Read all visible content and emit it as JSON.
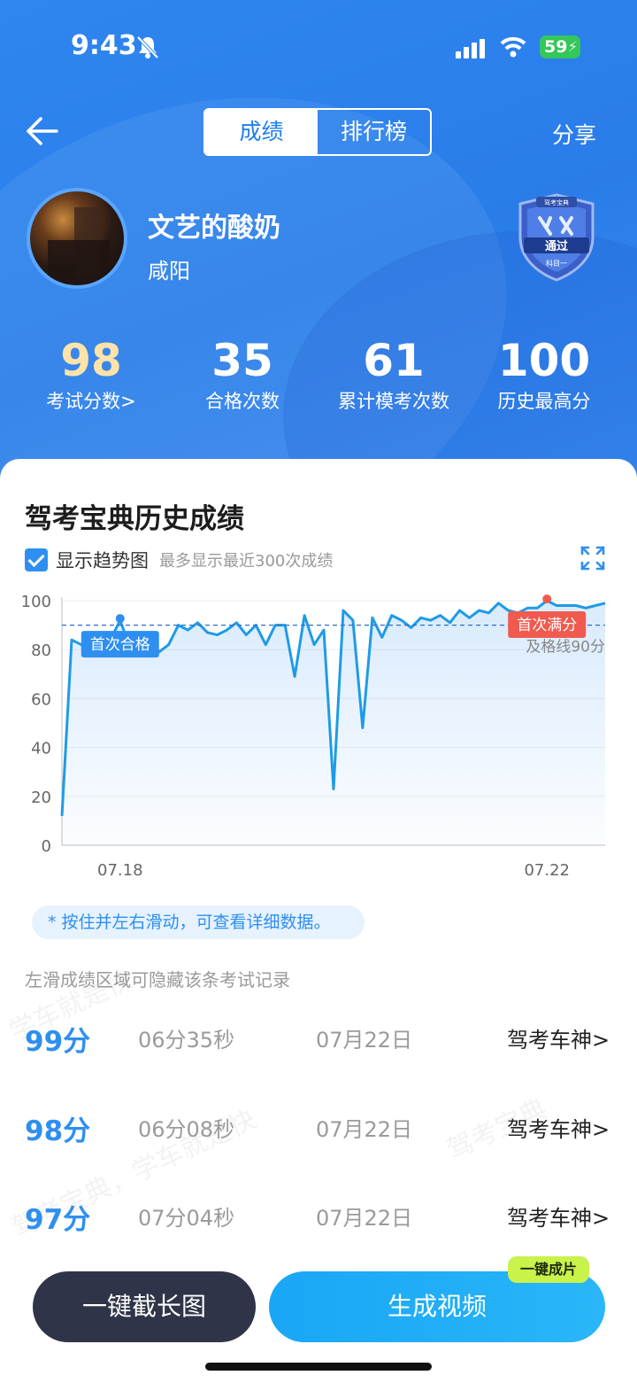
{
  "status_bar": {
    "time": "9:43",
    "battery": "59"
  },
  "header": {
    "tabs": [
      {
        "label": "成绩",
        "active": true
      },
      {
        "label": "排行榜",
        "active": false
      }
    ],
    "share_label": "分享"
  },
  "profile": {
    "name": "文艺的酸奶",
    "city": "咸阳",
    "badge": {
      "brand": "驾考宝典",
      "status": "通过",
      "subject": "科目一"
    }
  },
  "stats": [
    {
      "value": "98",
      "label": "考试分数>"
    },
    {
      "value": "35",
      "label": "合格次数"
    },
    {
      "value": "61",
      "label": "累计模考次数"
    },
    {
      "value": "100",
      "label": "历史最高分"
    }
  ],
  "history": {
    "title": "驾考宝典历史成绩",
    "trend_label": "显示趋势图",
    "trend_hint": "最多显示最近300次成绩",
    "slide_hint": "* 按住并左右滑动，可查看详细数据。",
    "hide_tip": "左滑成绩区域可隐藏该条考试记录"
  },
  "chart_data": {
    "type": "line",
    "ylim": [
      0,
      100
    ],
    "y_ticks": [
      "0",
      "20",
      "40",
      "60",
      "80",
      "100"
    ],
    "x_ticks": [
      "07.18",
      "07.22"
    ],
    "pass_line": {
      "value": 90,
      "label": "及格线90分"
    },
    "annotations": [
      {
        "label": "首次合格",
        "color": "#2e8ff0"
      },
      {
        "label": "首次满分",
        "color": "#f05a4f"
      }
    ],
    "series": [
      {
        "values": [
          12,
          84,
          82,
          79,
          81,
          84,
          92,
          81,
          86,
          85,
          79,
          82,
          90,
          88,
          91,
          87,
          86,
          88,
          91,
          86,
          90,
          82,
          90,
          90,
          69,
          94,
          82,
          88,
          23,
          96,
          92,
          48,
          93,
          85,
          94,
          92,
          89,
          93,
          92,
          94,
          91,
          96,
          93,
          96,
          95,
          99,
          96,
          95,
          97,
          97,
          100,
          98,
          98,
          98,
          97,
          98,
          99
        ]
      }
    ]
  },
  "records": [
    {
      "score": "99分",
      "time": "06分35秒",
      "date": "07月22日",
      "tag": "驾考车神>"
    },
    {
      "score": "98分",
      "time": "06分08秒",
      "date": "07月22日",
      "tag": "驾考车神>"
    },
    {
      "score": "97分",
      "time": "07分04秒",
      "date": "07月22日",
      "tag": "驾考车神>"
    }
  ],
  "watermarks": [
    "学车就是快",
    "驾考宝典，学车就是快",
    "驾考宝典"
  ],
  "buttons": {
    "screenshot": "一键截长图",
    "video": "生成视频",
    "video_tag": "一键成片"
  },
  "colors": {
    "primary": "#2e8ff0",
    "hero": "#2a7de9",
    "accent_red": "#f05a4f",
    "tag_green": "#c9f24a"
  }
}
